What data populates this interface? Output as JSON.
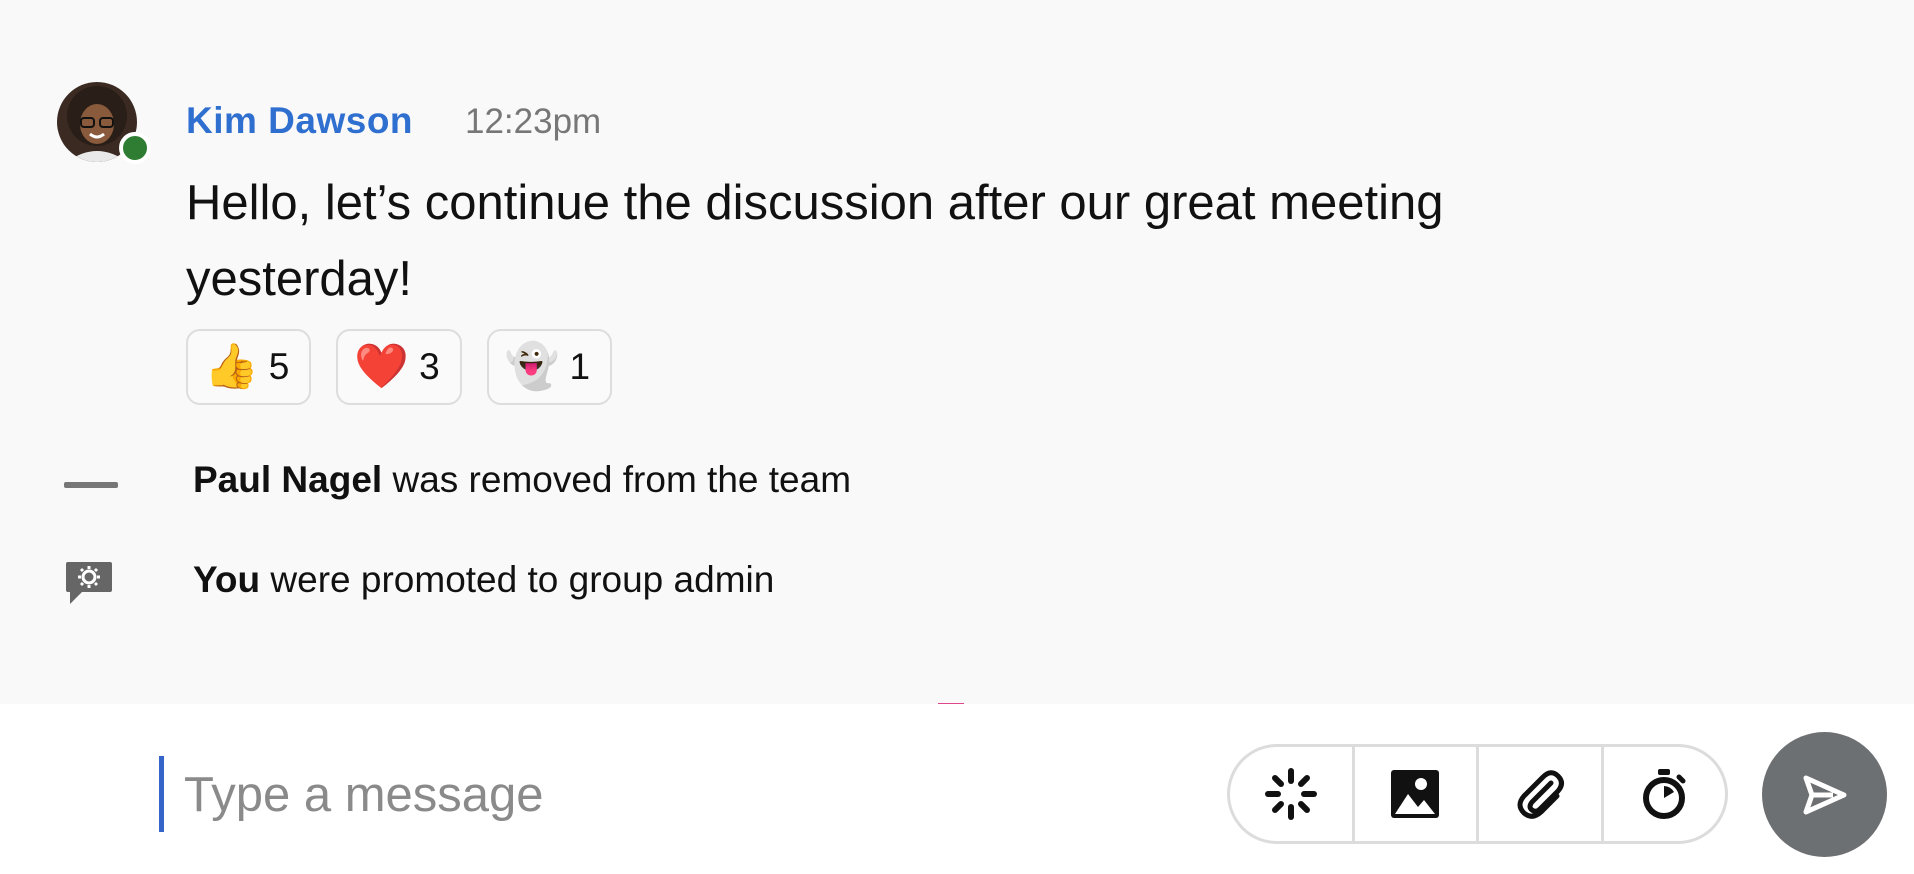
{
  "message": {
    "author": "Kim Dawson",
    "time": "12:23pm",
    "text": "Hello, let’s continue the discussion after our great meeting yesterday!",
    "presence_color": "#2e7d32",
    "reactions": [
      {
        "emoji": "👍",
        "count": "5"
      },
      {
        "emoji": "❤️",
        "count": "3"
      },
      {
        "emoji": "👻",
        "count": "1"
      }
    ]
  },
  "events": [
    {
      "icon": "dash-icon",
      "actor": "Paul Nagel",
      "text": " was removed from the team"
    },
    {
      "icon": "admin-badge-icon",
      "actor": "You",
      "text": " were promoted to group admin"
    }
  ],
  "composer": {
    "placeholder": "Type a message",
    "tools": [
      "sparkle-icon",
      "image-icon",
      "paperclip-icon",
      "timer-icon"
    ],
    "send_icon": "send-icon"
  },
  "colors": {
    "author": "#2f6fcf",
    "caret": "#3565c9",
    "send_button": "#6d7072"
  }
}
